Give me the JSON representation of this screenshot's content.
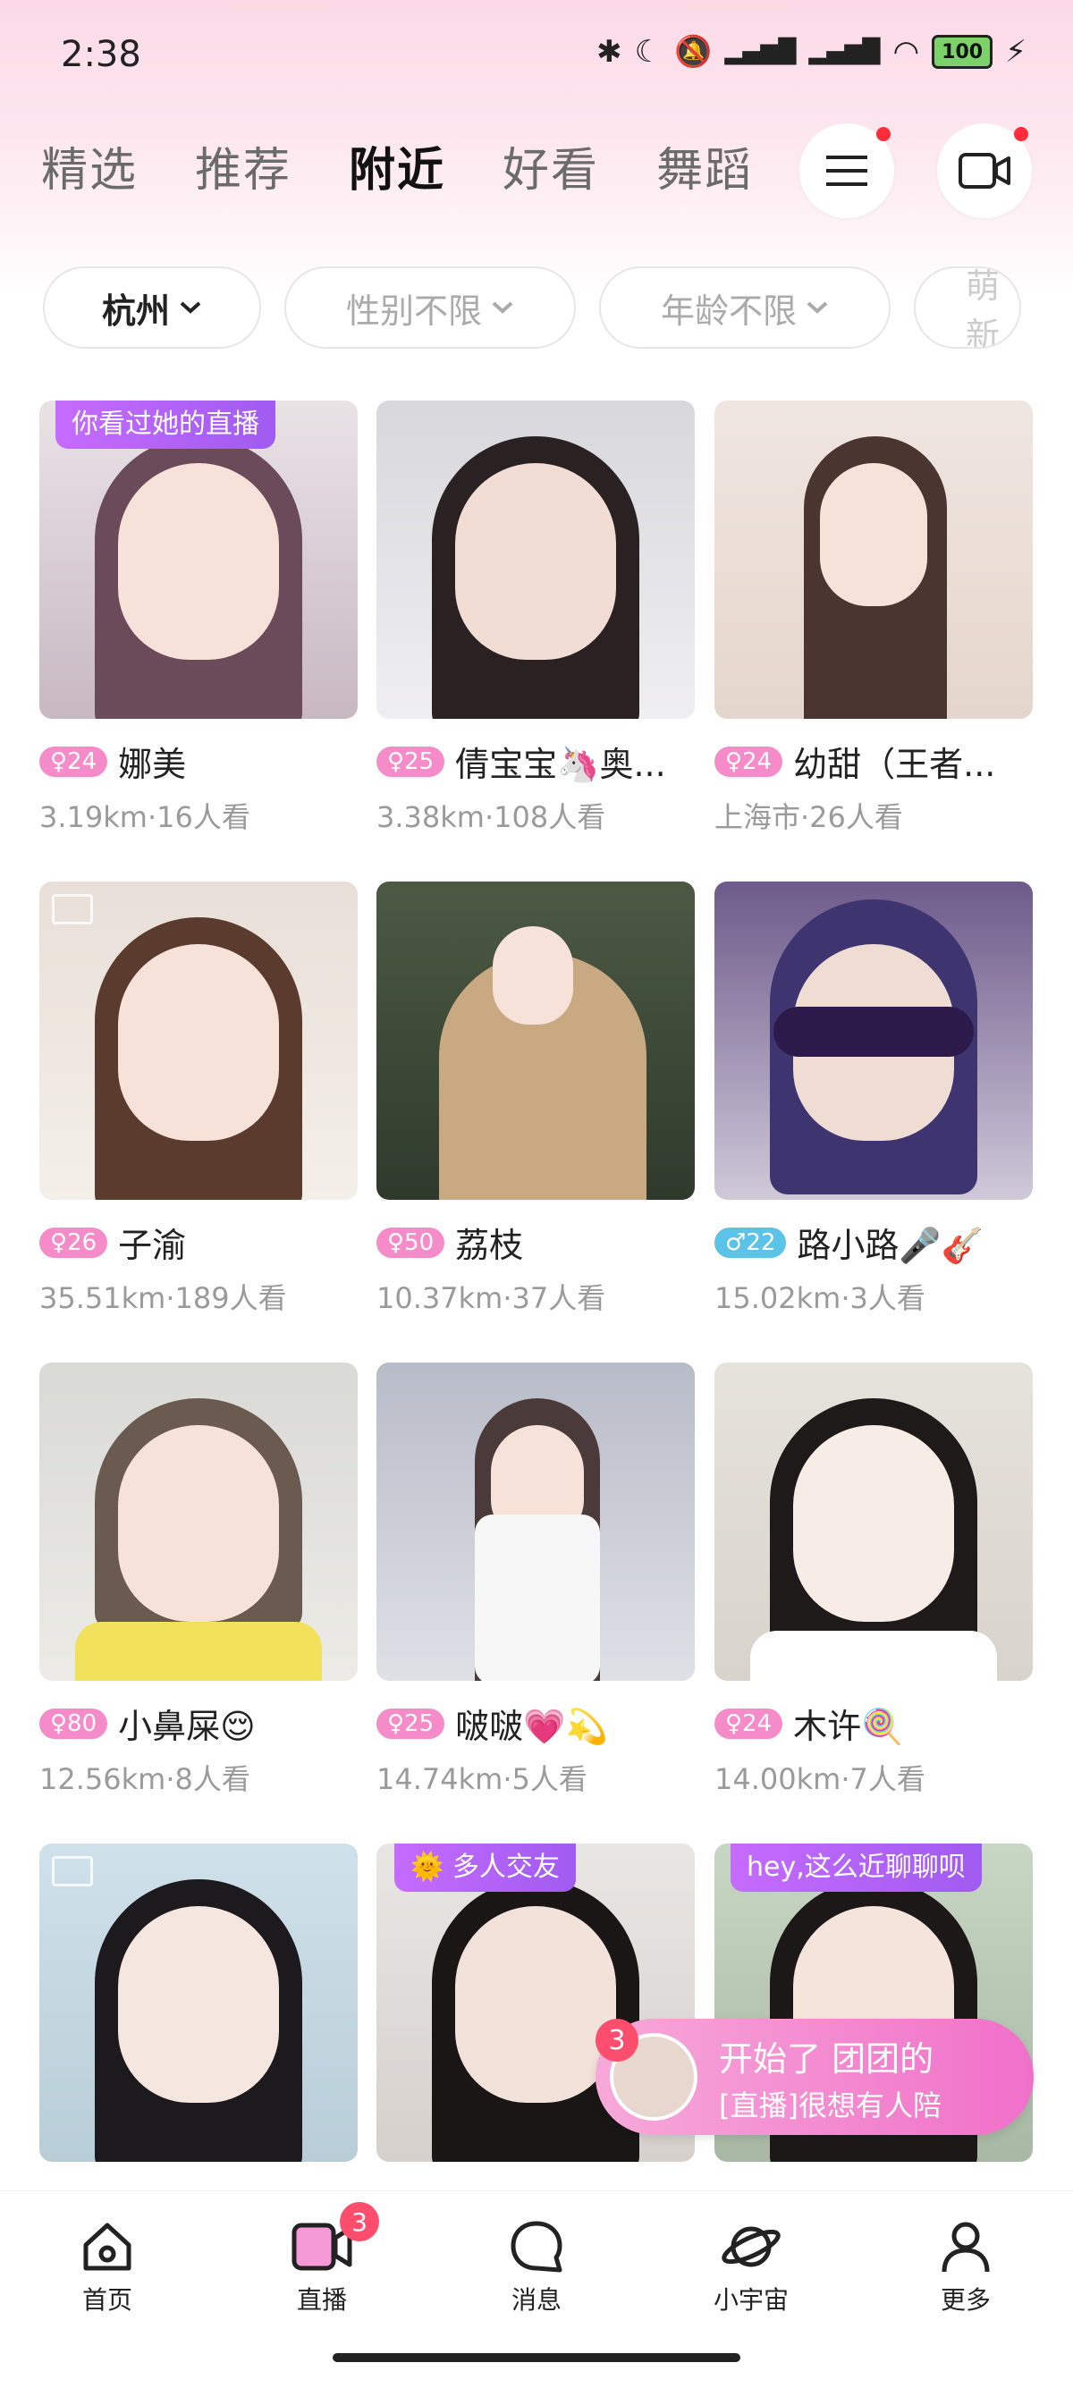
{
  "status": {
    "time": "2:38",
    "battery": "100"
  },
  "tabs": [
    "精选",
    "推荐",
    "附近",
    "好看",
    "舞蹈"
  ],
  "active_tab": 2,
  "filters": {
    "city": "杭州",
    "gender": "性别不限",
    "age": "年龄不限",
    "more": "萌新"
  },
  "cards": [
    {
      "tag": "你看过她的直播",
      "age": "24",
      "gender": "female",
      "name": "娜美",
      "info": "3.19km·16人看"
    },
    {
      "tag": "",
      "age": "25",
      "gender": "female",
      "name": "倩宝宝🦄奥...",
      "info": "3.38km·108人看"
    },
    {
      "tag": "",
      "age": "24",
      "gender": "female",
      "name": "幼甜（王者...",
      "info": "上海市·26人看"
    },
    {
      "tag": "",
      "age": "26",
      "gender": "female",
      "name": "子渝",
      "info": "35.51km·189人看"
    },
    {
      "tag": "",
      "age": "50",
      "gender": "female",
      "name": "荔枝",
      "info": "10.37km·37人看"
    },
    {
      "tag": "",
      "age": "22",
      "gender": "male",
      "name": "路小路🎤🎸",
      "info": "15.02km·3人看"
    },
    {
      "tag": "",
      "age": "80",
      "gender": "female",
      "name": "小鼻屎😌",
      "info": "12.56km·8人看"
    },
    {
      "tag": "",
      "age": "25",
      "gender": "female",
      "name": "啵啵💗💫",
      "info": "14.74km·5人看"
    },
    {
      "tag": "",
      "age": "24",
      "gender": "female",
      "name": "木许🍭",
      "info": "14.00km·7人看"
    },
    {
      "tag": "",
      "age": "",
      "gender": "female",
      "name": "",
      "info": ""
    },
    {
      "tag": "🌞 多人交友",
      "age": "",
      "gender": "female",
      "name": "",
      "info": ""
    },
    {
      "tag": "hey,这么近聊聊呗",
      "age": "",
      "gender": "female",
      "name": "",
      "info": ""
    }
  ],
  "notification": {
    "count": "3",
    "line1": "开始了   团团的",
    "line2": "[直播]很想有人陪"
  },
  "bottom_nav": [
    {
      "label": "首页",
      "icon": "home-icon"
    },
    {
      "label": "直播",
      "icon": "live-icon",
      "badge": "3"
    },
    {
      "label": "消息",
      "icon": "message-icon"
    },
    {
      "label": "小宇宙",
      "icon": "planet-icon"
    },
    {
      "label": "更多",
      "icon": "profile-icon"
    }
  ],
  "colors": {
    "accent": "#f070c9",
    "tag_purple": "#b065f8",
    "age_female": "#f58bc8",
    "age_male": "#5bc2e8"
  }
}
